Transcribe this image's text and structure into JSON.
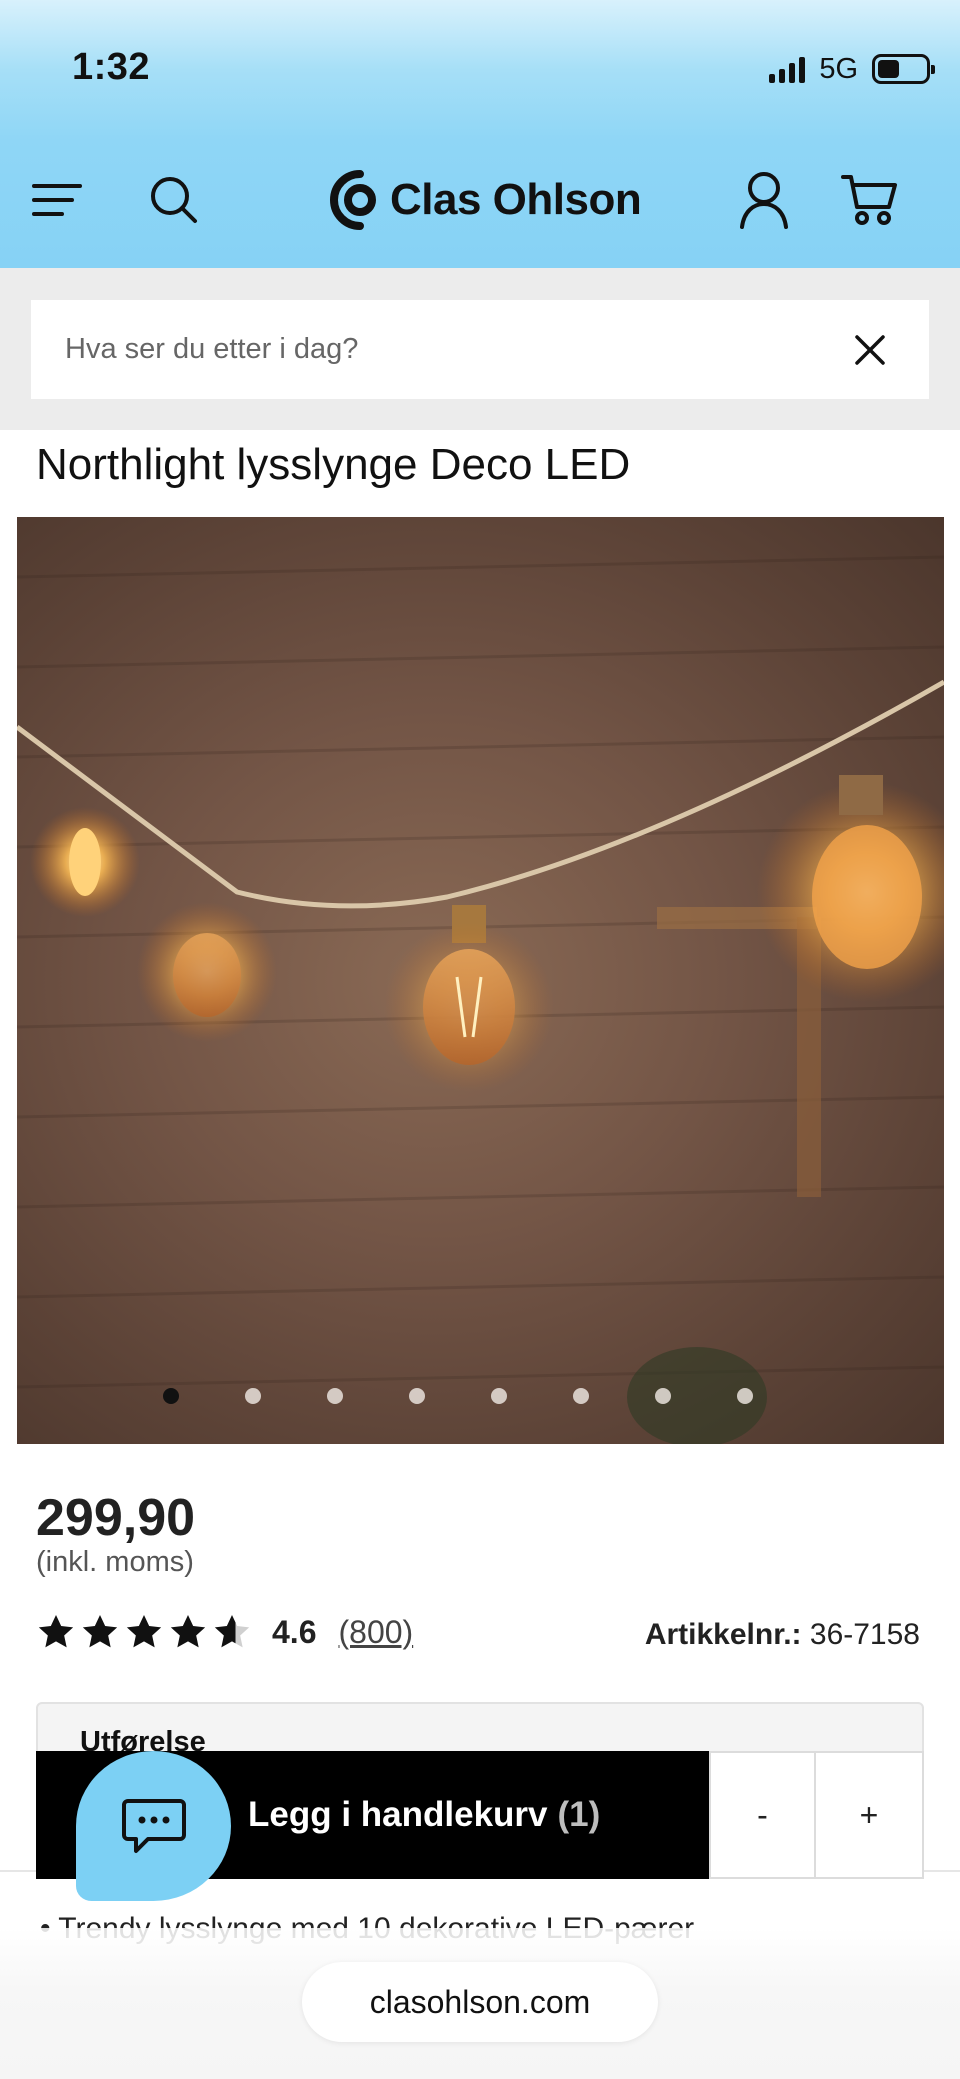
{
  "status_bar": {
    "time": "1:32",
    "network": "5G",
    "battery_level": 0.45
  },
  "header": {
    "brand": "Clas Ohlson",
    "icons": [
      "menu-icon",
      "search-icon",
      "account-icon",
      "cart-icon"
    ],
    "accent_color": "#86d2f5"
  },
  "search": {
    "placeholder": "Hva ser du etter i dag?",
    "value": ""
  },
  "product": {
    "title": "Northlight lysslynge Deco LED",
    "gallery": {
      "image_count": 8,
      "active_index": 0
    },
    "price": "299,90",
    "vat_note": "(inkl. moms)",
    "rating": {
      "stars": 4.6,
      "value": "4.6",
      "count": "(800)"
    },
    "article": {
      "label": "Artikkelnr.:",
      "number": "36-7158"
    },
    "variant_label": "Utførelse",
    "description_first_bullet": "Trendy lysslynge med 10 dekorative LED-pærer"
  },
  "cart_bar": {
    "add_label": "Legg i handlekurv",
    "count": "(1)",
    "decrement": "-",
    "increment": "+"
  },
  "browser": {
    "url": "clasohlson.com"
  }
}
